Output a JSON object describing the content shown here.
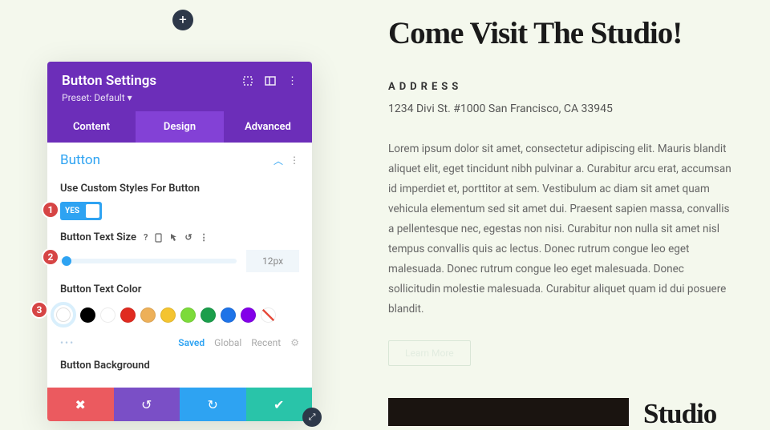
{
  "addButton": "+",
  "panel": {
    "title": "Button Settings",
    "preset": "Preset: Default ▾",
    "tabs": {
      "content": "Content",
      "design": "Design",
      "advanced": "Advanced"
    },
    "section": "Button",
    "useCustomLabel": "Use Custom Styles For Button",
    "toggleText": "YES",
    "textSizeLabel": "Button Text Size",
    "textSizeValue": "12px",
    "textColorLabel": "Button Text Color",
    "paletteSaved": "Saved",
    "paletteGlobal": "Global",
    "paletteRecent": "Recent",
    "bgLabel": "Button Background"
  },
  "colors": [
    "#000000",
    "#ffffff",
    "#e02b20",
    "#edb059",
    "#f4c430",
    "#7cdb3a",
    "#1b9e4b",
    "#1e73e8",
    "#8300e9"
  ],
  "badges": {
    "b1": "1",
    "b2": "2",
    "b3": "3"
  },
  "page": {
    "headline": "Come Visit The Studio!",
    "addressLabel": "ADDRESS",
    "address": "1234 Divi St. #1000 San Francisco, CA 33945",
    "paragraph": "Lorem ipsum dolor sit amet, consectetur adipiscing elit. Mauris blandit aliquet elit, eget tincidunt nibh pulvinar a. Curabitur arcu erat, accumsan id imperdiet et, porttitor at sem. Vestibulum ac diam sit amet quam vehicula elementum sed sit amet dui. Praesent sapien massa, convallis a pellentesque nec, egestas non nisi. Curabitur non nulla sit amet nisl tempus convallis quis ac lectus. Donec rutrum congue leo eget malesuada. Donec rutrum congue leo eget malesuada. Donec sollicitudin molestie malesuada. Curabitur aliquet quam id dui posuere blandit.",
    "ghostBtn": "Learn More",
    "studio": "Studio"
  }
}
